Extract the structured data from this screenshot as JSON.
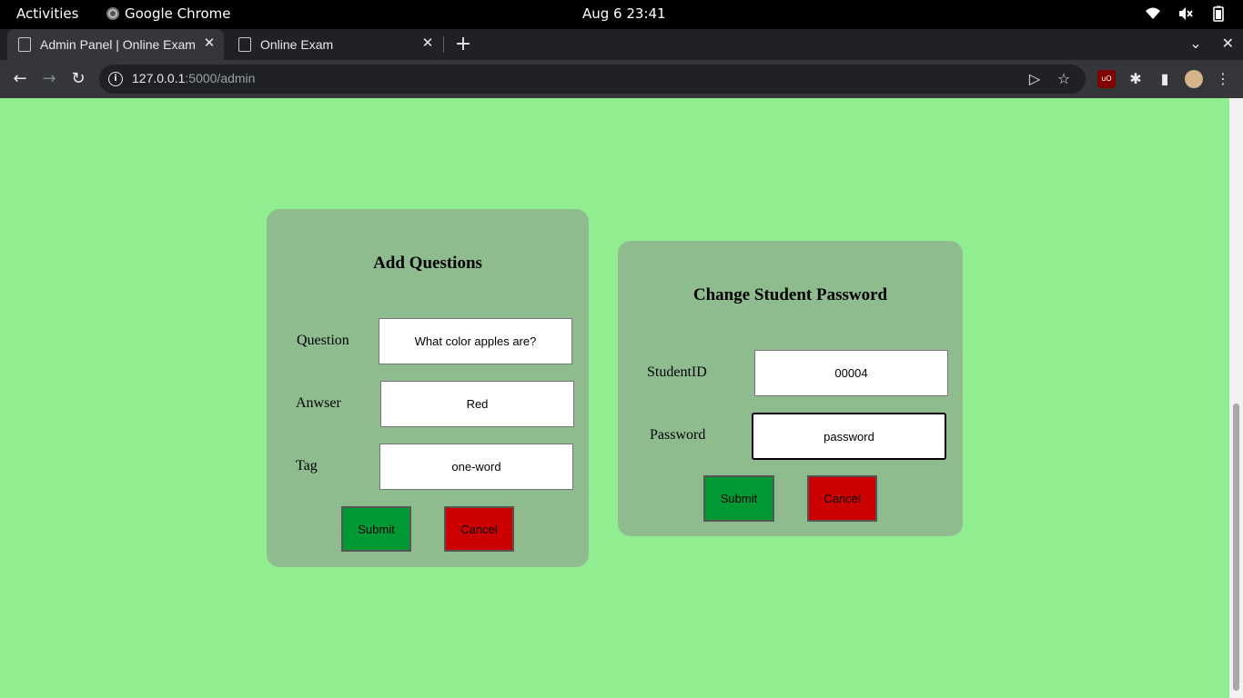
{
  "system": {
    "activities": "Activities",
    "app_name": "Google Chrome",
    "clock": "Aug 6  23:41"
  },
  "browser": {
    "tabs": [
      {
        "title": "Admin Panel | Online Exam",
        "active": true
      },
      {
        "title": "Online Exam",
        "active": false
      }
    ],
    "url_host": "127.0.0.1",
    "url_rest": ":5000/admin"
  },
  "add_questions": {
    "title": "Add Questions",
    "question_label": "Question",
    "question_value": "What color apples are?",
    "answer_label": "Anwser",
    "answer_value": "Red",
    "tag_label": "Tag",
    "tag_value": "one-word",
    "submit_label": "Submit",
    "cancel_label": "Cancel"
  },
  "change_password": {
    "title": "Change Student Password",
    "studentid_label": "StudentID",
    "studentid_value": "00004",
    "password_label": "Password",
    "password_value": "password",
    "submit_label": "Submit",
    "cancel_label": "Cancel"
  },
  "colors": {
    "page_bg": "#90ee90",
    "panel_bg": "#8fbc8f",
    "submit_bg": "#009933",
    "cancel_bg": "#cc0000"
  }
}
